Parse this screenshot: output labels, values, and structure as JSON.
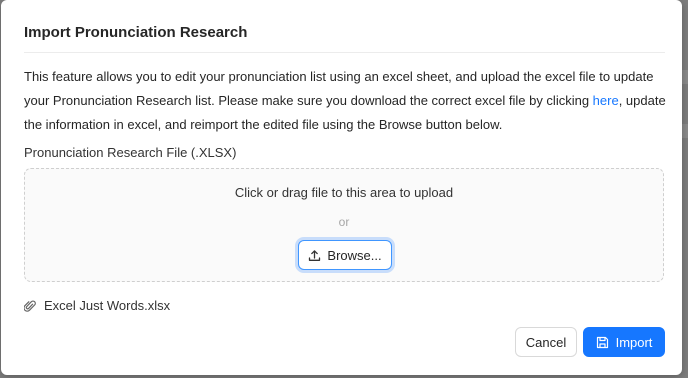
{
  "modal": {
    "title": "Import Pronunciation Research",
    "description": {
      "before_link": "This feature allows you to edit your pronunciation list using an excel sheet, and upload the excel file to update your Pronunciation Research list. Please make sure you download the correct excel file by clicking ",
      "link_text": "here",
      "after_link": ", update the information in excel, and reimport the edited file using the Browse button below."
    },
    "field_label": "Pronunciation Research File (.XLSX)",
    "dropzone": {
      "primary_text": "Click or drag file to this area to upload",
      "or_text": "or",
      "browse_label": "Browse...",
      "browse_icon": "upload-icon"
    },
    "attached_file": {
      "name": "Excel Just Words.xlsx",
      "icon": "paperclip-icon"
    },
    "footer": {
      "cancel_label": "Cancel",
      "import_label": "Import",
      "import_icon": "save-icon"
    },
    "colors": {
      "primary": "#1677ff",
      "link": "#1677ff",
      "backdrop": "#7d7d7d"
    }
  }
}
